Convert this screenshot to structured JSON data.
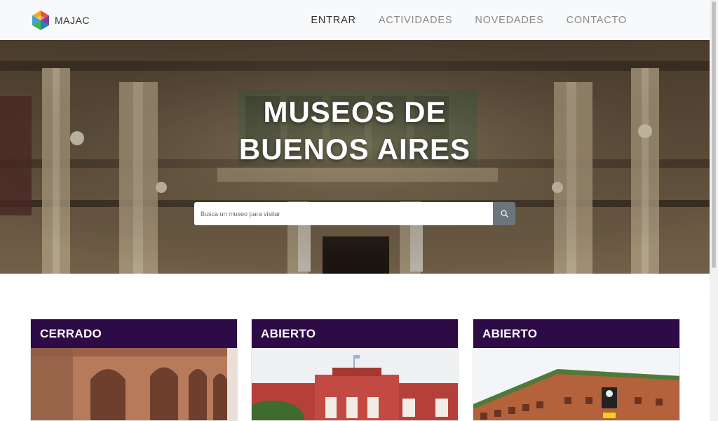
{
  "brand": {
    "name": "MAJAC",
    "logo_icon": "hexagon-cube-logo"
  },
  "nav": {
    "items": [
      {
        "label": "ENTRAR",
        "active": true
      },
      {
        "label": "ACTIVIDADES",
        "active": false
      },
      {
        "label": "NOVEDADES",
        "active": false
      },
      {
        "label": "CONTACTO",
        "active": false
      }
    ]
  },
  "hero": {
    "title_line1": "MUSEOS DE",
    "title_line2": "BUENOS AIRES",
    "search": {
      "placeholder": "Busca un museo para visitar",
      "button_icon": "search-icon"
    }
  },
  "cards": [
    {
      "status": "CERRADO"
    },
    {
      "status": "ABIERTO"
    },
    {
      "status": "ABIERTO"
    }
  ],
  "colors": {
    "navbar_bg": "#f8f9fa",
    "card_header": "#2e0a47",
    "search_button": "#6c757d",
    "logo": [
      "#e94e3c",
      "#f7a823",
      "#3aa3d9",
      "#4caf50",
      "#7b3fa0"
    ]
  }
}
